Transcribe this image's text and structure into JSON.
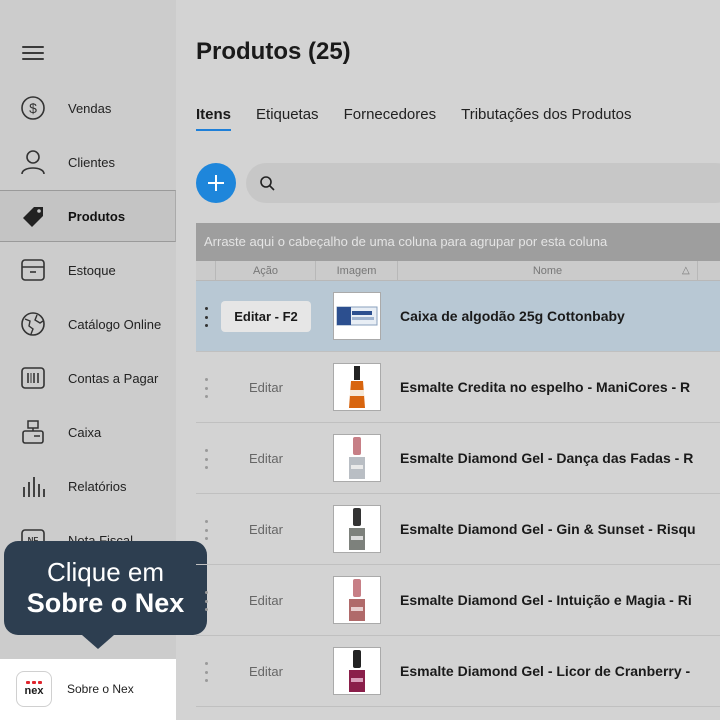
{
  "sidebar": {
    "items": [
      {
        "label": "Vendas",
        "icon": "dollar-circle-icon"
      },
      {
        "label": "Clientes",
        "icon": "person-icon"
      },
      {
        "label": "Produtos",
        "icon": "tag-icon",
        "active": true
      },
      {
        "label": "Estoque",
        "icon": "box-icon"
      },
      {
        "label": "Catálogo Online",
        "icon": "globe-icon"
      },
      {
        "label": "Contas a Pagar",
        "icon": "barcode-icon"
      },
      {
        "label": "Caixa",
        "icon": "cash-register-icon"
      },
      {
        "label": "Relatórios",
        "icon": "bar-chart-icon"
      },
      {
        "label": "Nota Fiscal",
        "icon": "nf-icon"
      }
    ],
    "about": {
      "label": "Sobre o Nex",
      "logo_text": "nex"
    }
  },
  "tooltip": {
    "line1": "Clique em",
    "line2": "Sobre o Nex"
  },
  "main": {
    "title": "Produtos (25)",
    "tabs": [
      {
        "label": "Itens",
        "active": true
      },
      {
        "label": "Etiquetas"
      },
      {
        "label": "Fornecedores"
      },
      {
        "label": "Tributações dos Produtos"
      }
    ],
    "search": {
      "placeholder": "",
      "value": ""
    },
    "group_hint": "Arraste aqui o cabeçalho de uma coluna para agrupar por esta coluna",
    "columns": {
      "action": "Ação",
      "image": "Imagem",
      "name": "Nome",
      "sort_indicator": "△"
    },
    "rows": [
      {
        "edit": "Editar - F2",
        "name": "Caixa de algodão 25g Cottonbaby",
        "selected": true,
        "thumb": "cotton-box"
      },
      {
        "edit": "Editar",
        "name": "Esmalte Credita no espelho - ManiCores - R",
        "thumb": "polish-orange"
      },
      {
        "edit": "Editar",
        "name": "Esmalte Diamond Gel - Dança das Fadas - R",
        "thumb": "polish-silver"
      },
      {
        "edit": "Editar",
        "name": "Esmalte Diamond Gel - Gin & Sunset - Risqu",
        "thumb": "polish-gray"
      },
      {
        "edit": "Editar",
        "name": "Esmalte Diamond Gel - Intuição e Magia - Ri",
        "thumb": "polish-rose"
      },
      {
        "edit": "Editar",
        "name": "Esmalte Diamond Gel - Licor de Cranberry -",
        "thumb": "polish-berry"
      }
    ]
  },
  "colors": {
    "accent": "#1e86db",
    "tooltip_bg": "#2d3e50",
    "selected_row": "#b8c8d4",
    "logo_red": "#e0242c"
  }
}
